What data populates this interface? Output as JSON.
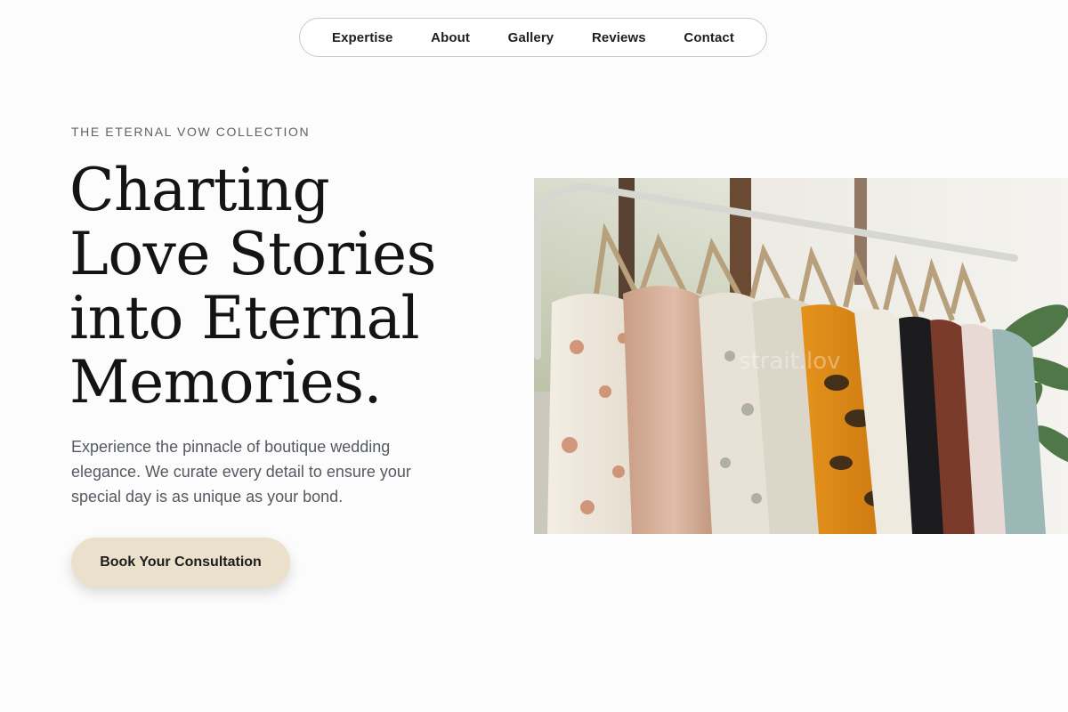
{
  "nav": {
    "items": [
      {
        "label": "Expertise"
      },
      {
        "label": "About"
      },
      {
        "label": "Gallery"
      },
      {
        "label": "Reviews"
      },
      {
        "label": "Contact"
      }
    ]
  },
  "hero": {
    "eyebrow": "THE ETERNAL VOW COLLECTION",
    "headline_lines": [
      "Charting",
      "Love Stories",
      "into Eternal",
      "Memories."
    ],
    "description": "Experience the pinnacle of boutique wedding elegance. We curate every detail to ensure your special day is as unique as your bond.",
    "cta_label": "Book Your Consultation",
    "image": {
      "subject": "clothing rack with garments on wooden hangers",
      "watermark": "strait.lov"
    }
  },
  "colors": {
    "background": "#fcfcfc",
    "cta_background": "#eae0cb",
    "text_primary": "#141414",
    "text_secondary": "#555a62"
  }
}
